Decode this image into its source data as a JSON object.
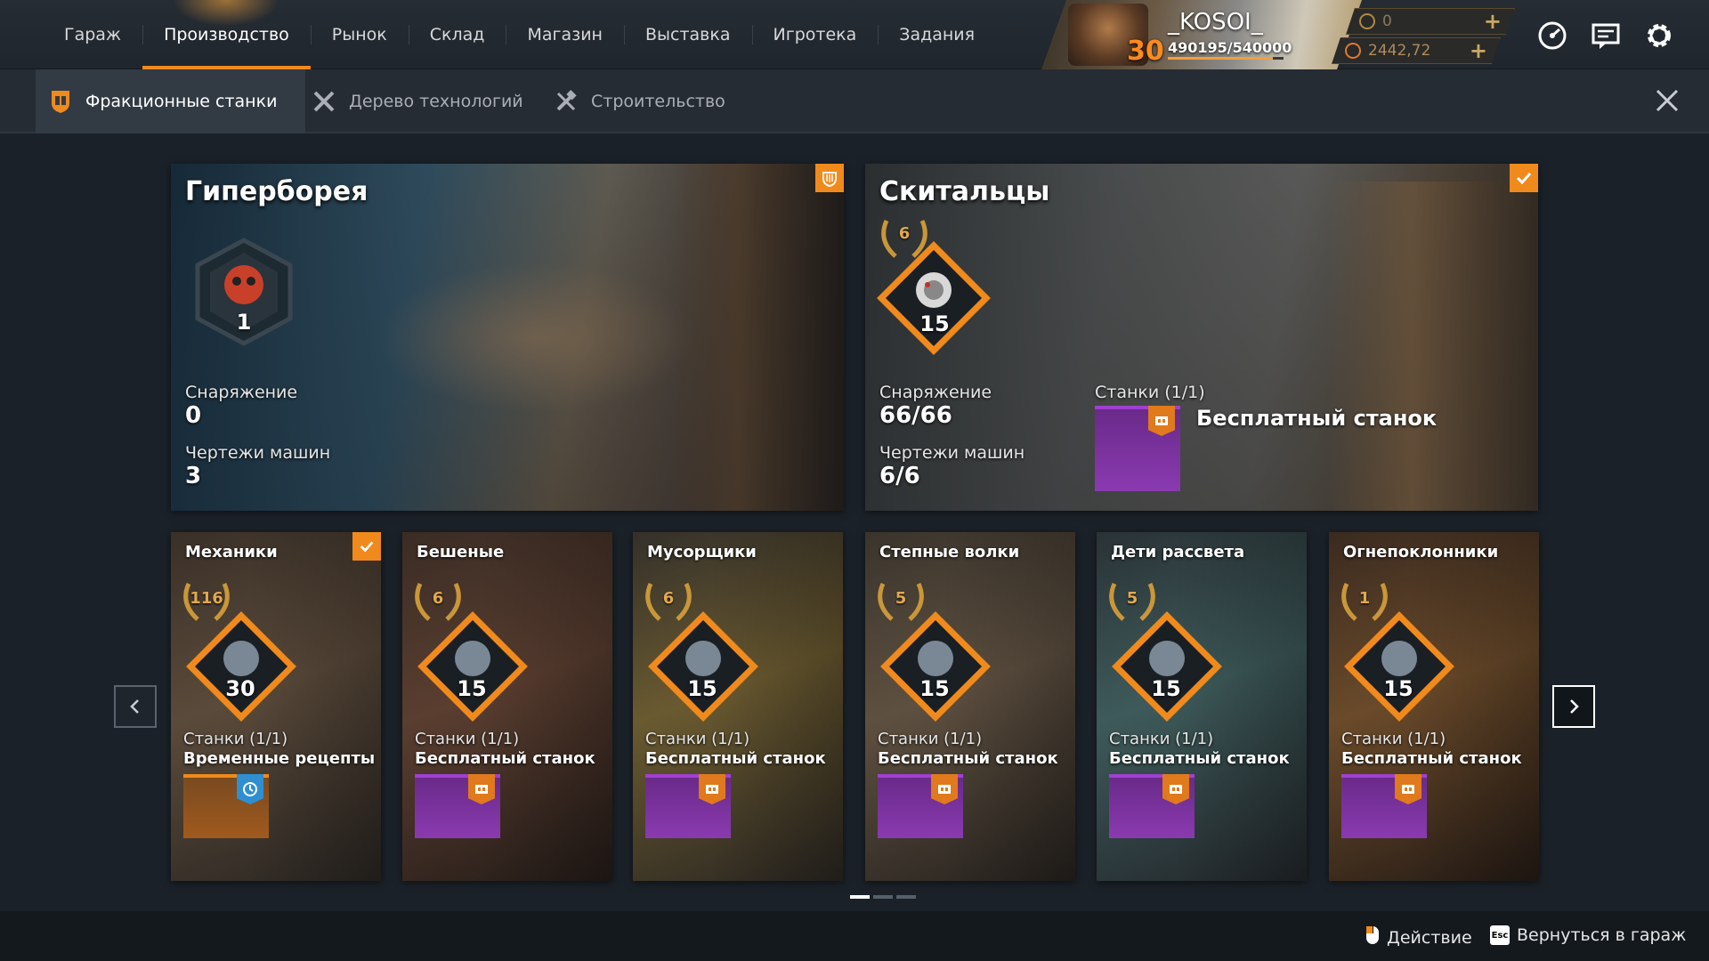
{
  "nav": {
    "items": [
      {
        "label": "Гараж"
      },
      {
        "label": "Производство"
      },
      {
        "label": "Рынок"
      },
      {
        "label": "Склад"
      },
      {
        "label": "Магазин"
      },
      {
        "label": "Выставка"
      },
      {
        "label": "Игротека"
      },
      {
        "label": "Задания"
      }
    ],
    "active_index": 1
  },
  "profile": {
    "name": "_KOSOI_",
    "level": "30",
    "xp": "490195/540000",
    "xp_progress": 0.908
  },
  "currency": {
    "coins": {
      "value": "0",
      "icon": "coin-icon"
    },
    "crystals": {
      "value": "2442,72",
      "icon": "crystal-icon"
    }
  },
  "top_icons": [
    "speedometer-icon",
    "chat-icon",
    "gear-icon"
  ],
  "subtabs": [
    {
      "label": "Фракционные станки",
      "icon": "faction-shield-icon"
    },
    {
      "label": "Дерево технологий",
      "icon": "wrench-cross-icon"
    },
    {
      "label": "Строительство",
      "icon": "hammer-cross-icon"
    }
  ],
  "cards": {
    "hyperborea": {
      "title": "Гиперборея",
      "level": "1",
      "equipment_label": "Снаряжение",
      "equipment_value": "0",
      "blueprints_label": "Чертежи машин",
      "blueprints_value": "3"
    },
    "wanderers": {
      "title": "Скитальцы",
      "reputation": "6",
      "level": "15",
      "equipment_label": "Снаряжение",
      "equipment_value": "66/66",
      "blueprints_label": "Чертежи машин",
      "blueprints_value": "6/6",
      "machines_label": "Станки (1/1)",
      "machine_status": "Бесплатный станок",
      "checked": true
    }
  },
  "small_cards": [
    {
      "title": "Механики",
      "reputation": "116",
      "level": "30",
      "machines": "Станки (1/1)",
      "status": "Временные рецепты",
      "checked": true,
      "accent": "#f08a1c"
    },
    {
      "title": "Бешеные",
      "reputation": "6",
      "level": "15",
      "machines": "Станки (1/1)",
      "status": "Бесплатный станок",
      "checked": false,
      "accent": "#a040d0"
    },
    {
      "title": "Мусорщики",
      "reputation": "6",
      "level": "15",
      "machines": "Станки (1/1)",
      "status": "Бесплатный станок",
      "checked": false,
      "accent": "#a040d0"
    },
    {
      "title": "Степные волки",
      "reputation": "5",
      "level": "15",
      "machines": "Станки (1/1)",
      "status": "Бесплатный станок",
      "checked": false,
      "accent": "#a040d0"
    },
    {
      "title": "Дети рассвета",
      "reputation": "5",
      "level": "15",
      "machines": "Станки (1/1)",
      "status": "Бесплатный станок",
      "checked": false,
      "accent": "#a040d0"
    },
    {
      "title": "Огнепоклонники",
      "reputation": "1",
      "level": "15",
      "machines": "Станки (1/1)",
      "status": "Бесплатный станок",
      "checked": false,
      "accent": "#a040d0"
    }
  ],
  "pager": {
    "pages": 3,
    "current": 1
  },
  "footer": {
    "action_label": "Действие",
    "action_key": "mouse-icon",
    "back_label": "Вернуться в гараж",
    "back_key": "Esc"
  },
  "colors": {
    "accent": "#f08a1c",
    "purple": "#a040d0",
    "background": "#1b2128"
  }
}
